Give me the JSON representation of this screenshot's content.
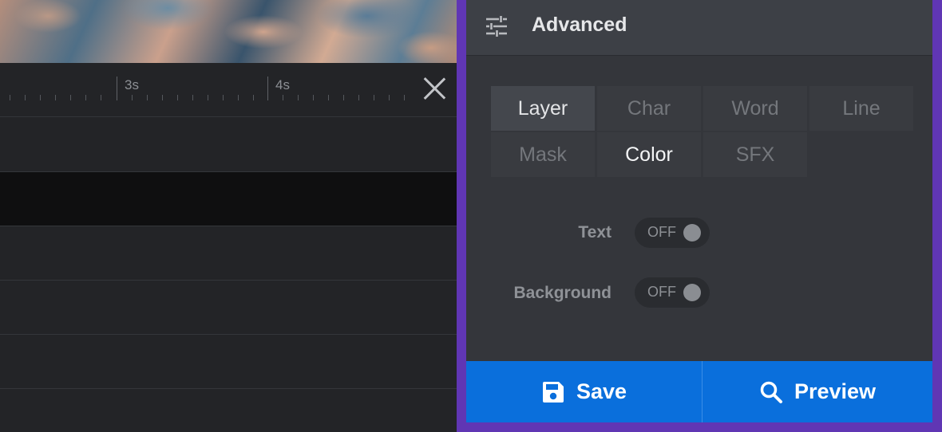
{
  "timeline": {
    "tick_labels": [
      "3s",
      "4s"
    ]
  },
  "panel": {
    "title": "Advanced",
    "icon": "sliders-icon",
    "tabs": [
      {
        "label": "Layer",
        "state": "active"
      },
      {
        "label": "Char",
        "state": "inactive"
      },
      {
        "label": "Word",
        "state": "inactive"
      },
      {
        "label": "Line",
        "state": "inactive"
      },
      {
        "label": "Mask",
        "state": "inactive"
      },
      {
        "label": "Color",
        "state": "selected"
      },
      {
        "label": "SFX",
        "state": "inactive"
      }
    ],
    "options": [
      {
        "label": "Text",
        "toggle": "OFF"
      },
      {
        "label": "Background",
        "toggle": "OFF"
      }
    ],
    "buttons": {
      "save_label": "Save",
      "save_icon": "floppy-disk-icon",
      "preview_label": "Preview",
      "preview_icon": "search-icon"
    }
  },
  "colors": {
    "frame_accent": "#6036b4",
    "button_blue": "#0a6fdc",
    "panel_bg": "#34363b"
  }
}
